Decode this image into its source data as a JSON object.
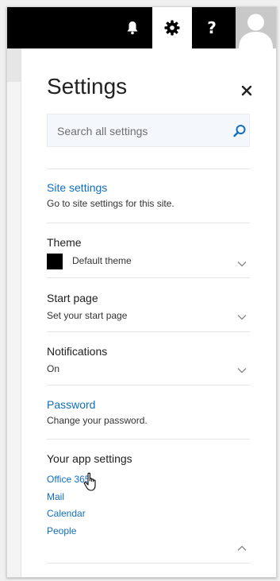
{
  "header": {
    "title": "Settings",
    "search_placeholder": "Search all settings"
  },
  "site_settings": {
    "title": "Site settings",
    "description": "Go to site settings for this site."
  },
  "theme": {
    "title": "Theme",
    "value": "Default theme",
    "swatch_color": "#000000"
  },
  "start_page": {
    "title": "Start page",
    "value": "Set your start page"
  },
  "notifications": {
    "title": "Notifications",
    "value": "On"
  },
  "password": {
    "title": "Password",
    "description": "Change your password."
  },
  "app_settings": {
    "title": "Your app settings",
    "links": [
      "Office 365",
      "Mail",
      "Calendar",
      "People"
    ]
  },
  "colors": {
    "link": "#106ebe",
    "topbar": "#000000"
  }
}
